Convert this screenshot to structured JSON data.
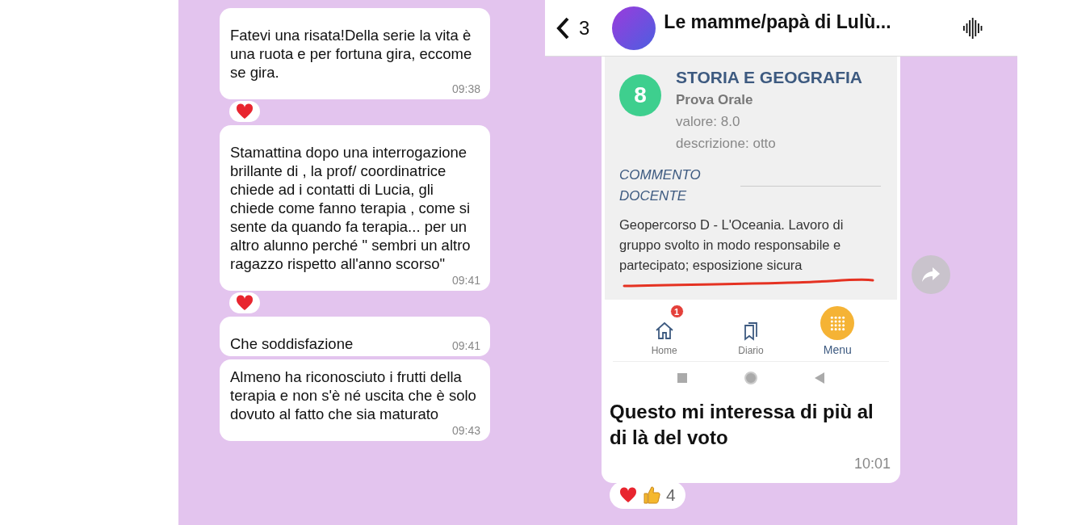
{
  "left_chat": {
    "messages": [
      {
        "text": "Fatevi una risata!Della serie la vita è una ruota e per fortuna gira, eccome se gira.",
        "time": "09:38",
        "reactions": [
          {
            "kind": "heart"
          }
        ]
      },
      {
        "text": "Stamattina dopo una interrogazione brillante di , la prof/ coordinatrice chiede ad i contatti di Lucia, gli chiede come fanno terapia , come si sente da quando fa terapia... per un altro alunno perché \" sembri un altro ragazzo rispetto all'anno scorso\"",
        "time": "09:41",
        "reactions": [
          {
            "kind": "heart"
          }
        ]
      },
      {
        "text": "Che soddisfazione",
        "time": "09:41"
      },
      {
        "text": "Almeno ha riconosciuto i frutti della terapia e non s'è né uscita che è solo dovuto al fatto che sia maturato",
        "time": "09:43"
      }
    ]
  },
  "right_chat": {
    "header": {
      "back_count": "3",
      "title": "Le mamme/papà di Lulù..."
    },
    "message": {
      "screenshot": {
        "grade": "8",
        "subject": "STORIA E GEOGRAFIA",
        "test_type": "Prova Orale",
        "value": "valore: 8.0",
        "description": "descrizione: otto",
        "comment_heading": "COMMENTO DOCENTE",
        "comment": "Geopercorso D - L'Oceania. Lavoro di gruppo svolto in modo responsabile e partecipato; esposizione sicura",
        "nav": [
          {
            "kind": "home",
            "label": "Home",
            "badge": "1",
            "selected": false
          },
          {
            "kind": "diary",
            "label": "Diario",
            "selected": false
          },
          {
            "kind": "menu",
            "label": "Menu",
            "selected": true
          }
        ]
      },
      "text": "Questo mi interessa di più al di là del voto",
      "time": "10:01",
      "reactions": [
        {
          "kind": "heart"
        },
        {
          "kind": "thumbs-up"
        }
      ],
      "reaction_count": "4"
    }
  }
}
